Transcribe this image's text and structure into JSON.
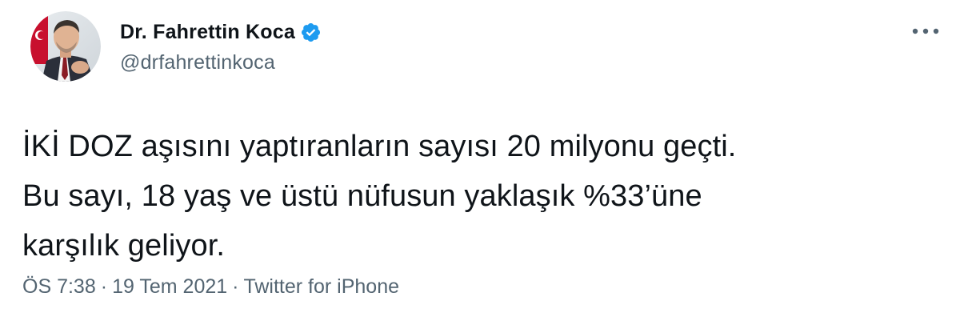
{
  "author": {
    "display_name": "Dr. Fahrettin Koca",
    "handle": "@drfahrettinkoca",
    "verified": true,
    "verified_badge_color": "#1d9bf0"
  },
  "tweet": {
    "text_lines": [
      "İKİ DOZ aşısını yaptıranların sayısı 20 milyonu geçti.",
      "Bu sayı, 18 yaş ve üstü nüfusun yaklaşık %33’üne",
      "karşılık geliyor."
    ],
    "time": "ÖS 7:38",
    "separator": "·",
    "date": "19 Tem 2021",
    "source": "Twitter for iPhone"
  },
  "icons": {
    "more": "more-horizontal-icon",
    "verified": "verified-badge-icon",
    "avatar": "avatar-photo"
  },
  "colors": {
    "text": "#0f1419",
    "secondary": "#536471",
    "accent": "#1d9bf0"
  }
}
